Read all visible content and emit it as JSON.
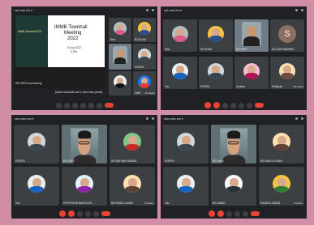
{
  "q1": {
    "meetbar_title": "xxx-xxxx-xxx ▾",
    "slide": {
      "title_line1": "IMMB Townhall",
      "title_line2": "Meeting",
      "title_line3": "2022",
      "date": "9 Aug 2022",
      "time": "3 PM",
      "left_title": "IMMB Townhall 2022",
      "presenting": "DR HIDO is presenting",
      "caption": "[online microsoft and 3 more have joined]"
    },
    "tiles": [
      "Wan",
      "ROSLINA",
      "",
      "KORITA",
      "",
      "ZAIN"
    ],
    "others_label": "16 others"
  },
  "q2": {
    "meetbar_title": "xxx-xxxx-xxx ▾",
    "tiles": [
      "Wan",
      "ROSLINA",
      "DR HIDO",
      "DR NUR SABRINA",
      "You",
      "KORITA",
      "Azriana",
      "Khairiyah"
    ],
    "letter": "S",
    "others_label": "20 others"
  },
  "q3": {
    "meetbar_title": "xxxx-xxxx-xxx ▾",
    "tiles": [
      "KORITA",
      "DR HIDO",
      "DR NAFIDAH ADNAN",
      "You",
      "PROFESOR MADYA DR ...",
      "DR NURUL ILMAH"
    ],
    "others_label": "5 others"
  },
  "q4": {
    "meetbar_title": "xxxx-xxxx-xxx ▾",
    "tiles": [
      "KORITA",
      "DR HIDO",
      "DR NURUL ILMAH",
      "You",
      "DR JAMAL",
      "KAIZRUL NIZAM"
    ],
    "others_label": "5 others"
  }
}
